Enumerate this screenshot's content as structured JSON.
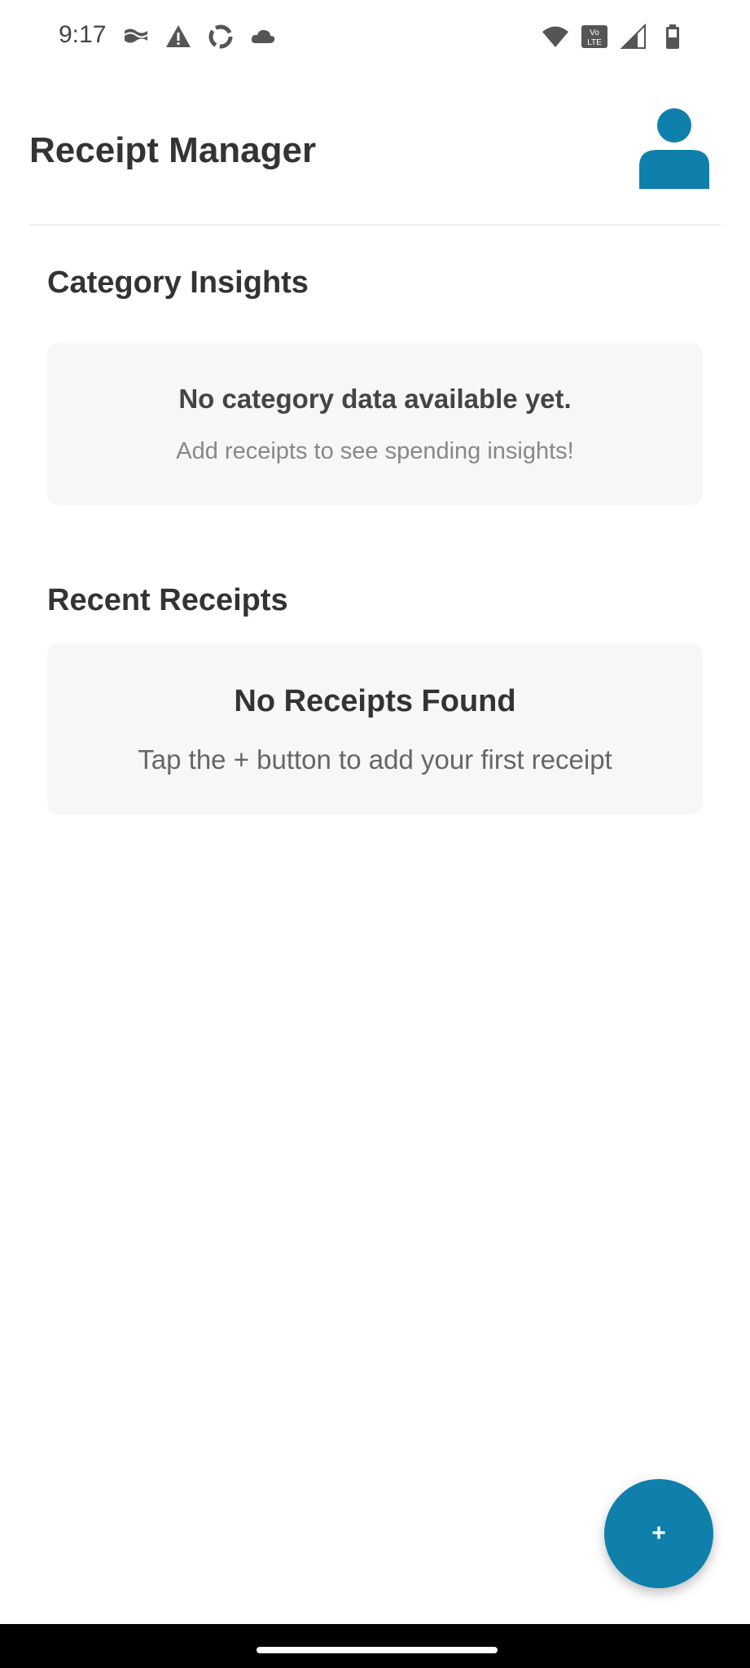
{
  "status_bar": {
    "time": "9:17",
    "left_icons": [
      "flag-icon",
      "warning-icon",
      "sync-icon",
      "cloud-icon"
    ],
    "right_icons": [
      "wifi-icon",
      "volte-icon",
      "signal-icon",
      "battery-icon"
    ],
    "volte_text": "Vo LTE"
  },
  "header": {
    "title": "Receipt Manager",
    "profile_icon": "person-icon"
  },
  "insights": {
    "section_title": "Category Insights",
    "empty_title": "No category data available yet.",
    "empty_subtitle": "Add receipts to see spending insights!"
  },
  "receipts": {
    "section_title": "Recent Receipts",
    "empty_title": "No Receipts Found",
    "empty_subtitle": "Tap the + button to add your first receipt"
  },
  "fab": {
    "label": "+"
  },
  "colors": {
    "accent": "#0f7fab",
    "card_background": "#f7f7f7",
    "text_primary": "#333333",
    "text_muted": "#888888"
  }
}
